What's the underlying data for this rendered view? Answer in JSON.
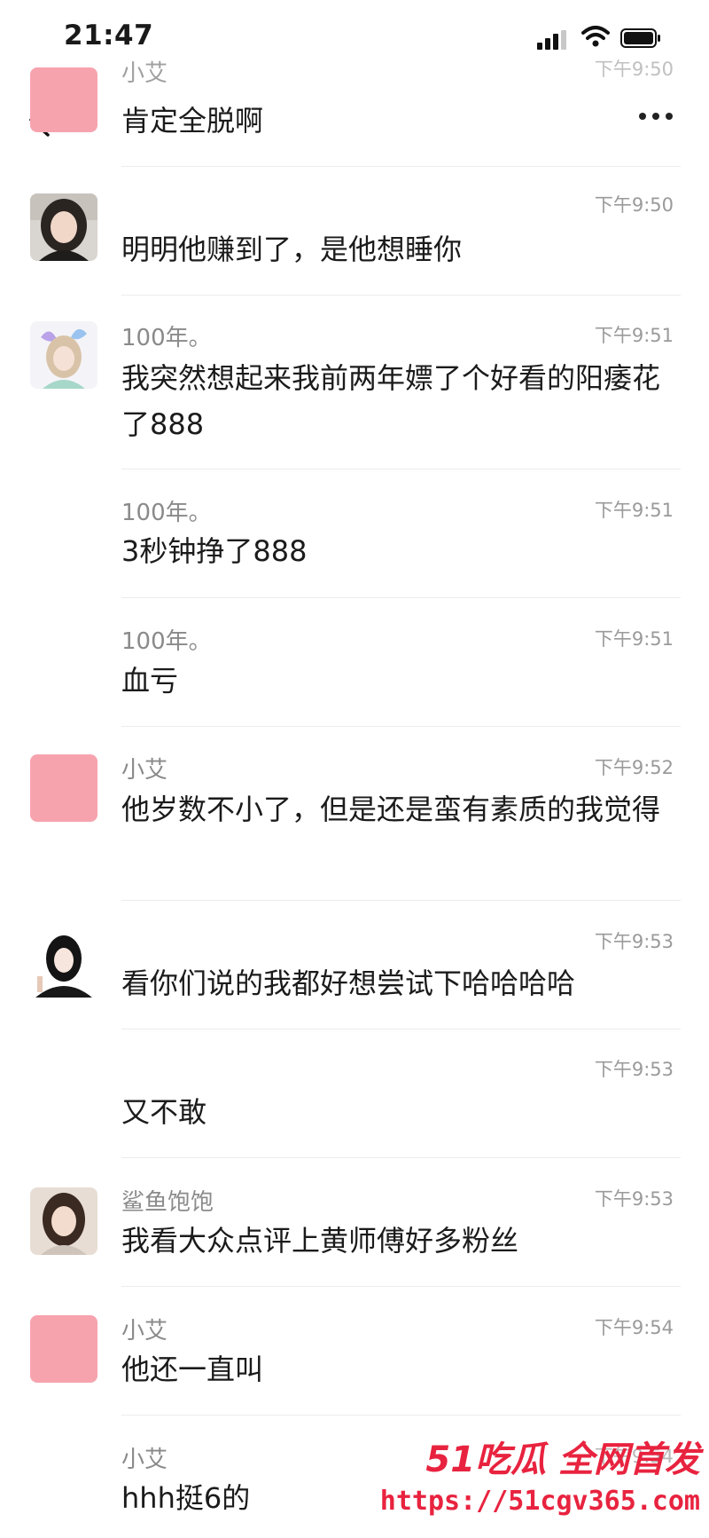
{
  "status_bar": {
    "time": "21:47"
  },
  "messages": [
    {
      "sender": "小艾",
      "time": "下午9:50",
      "text": "肯定全脱啊"
    },
    {
      "sender": "",
      "time": "下午9:50",
      "text": "明明他赚到了，是他想睡你"
    },
    {
      "sender": "100年。",
      "time": "下午9:51",
      "text": "我突然想起来我前两年嫖了个好看的阳痿花了888"
    },
    {
      "sender": "100年。",
      "time": "下午9:51",
      "text": "3秒钟挣了888"
    },
    {
      "sender": "100年。",
      "time": "下午9:51",
      "text": "血亏"
    },
    {
      "sender": "小艾",
      "time": "下午9:52",
      "text": "他岁数不小了，但是还是蛮有素质的我觉得"
    },
    {
      "sender": "",
      "time": "下午9:53",
      "text": "看你们说的我都好想尝试下哈哈哈哈"
    },
    {
      "sender": "",
      "time": "下午9:53",
      "text": "又不敢"
    },
    {
      "sender": "鲨鱼饱饱",
      "time": "下午9:53",
      "text": "我看大众点评上黄师傅好多粉丝"
    },
    {
      "sender": "小艾",
      "time": "下午9:54",
      "text": "他还一直叫"
    },
    {
      "sender": "小艾",
      "time": "下午9:54",
      "text": "hhh挺6的"
    }
  ],
  "watermark": {
    "brand": "51吃瓜 全网首发",
    "url": "https://51cgv365.com"
  },
  "colors": {
    "avatar_pink": "#f7a3ae",
    "watermark_red": "#e8233f",
    "meta_gray": "#9a9a9a"
  },
  "icons": [
    "back-icon",
    "more-icon",
    "signal-icon",
    "wifi-icon",
    "battery-icon"
  ]
}
